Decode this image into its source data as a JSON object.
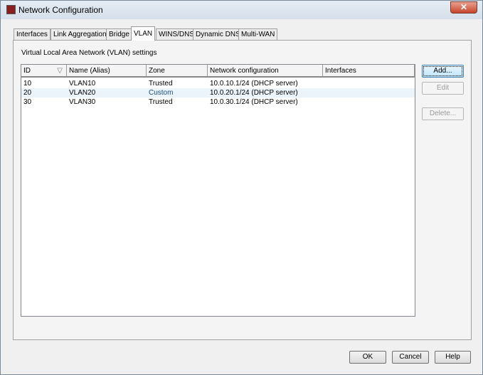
{
  "window": {
    "title": "Network Configuration",
    "close": "✕"
  },
  "tabs": [
    "Interfaces",
    "Link Aggregation",
    "Bridge",
    "VLAN",
    "WINS/DNS",
    "Dynamic DNS",
    "Multi-WAN"
  ],
  "active_tab": "VLAN",
  "caption": "Virtual Local Area Network (VLAN) settings",
  "table": {
    "columns": [
      "ID",
      "Name (Alias)",
      "Zone",
      "Network configuration",
      "Interfaces"
    ],
    "sort_icon": "▽",
    "rows": [
      [
        "10",
        "VLAN10",
        "Trusted",
        "10.0.10.1/24 (DHCP server)",
        ""
      ],
      [
        "20",
        "VLAN20",
        "Custom",
        "10.0.20.1/24 (DHCP server)",
        ""
      ],
      [
        "30",
        "VLAN30",
        "Trusted",
        "10.0.30.1/24 (DHCP server)",
        ""
      ]
    ]
  },
  "side_buttons": {
    "add": "Add...",
    "edit": "Edit",
    "delete": "Delete..."
  },
  "footer": {
    "ok": "OK",
    "cancel": "Cancel",
    "help": "Help"
  },
  "colors": {
    "custom_zone": "#1a4f7a",
    "selected_row": "#ebf3fb"
  }
}
